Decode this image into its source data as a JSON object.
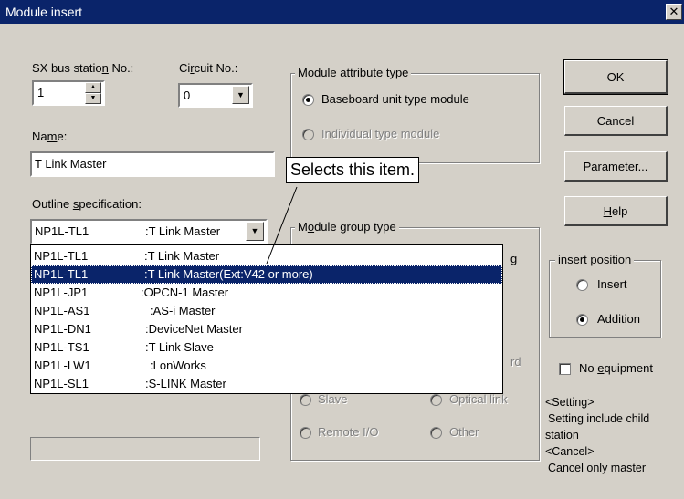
{
  "window": {
    "title": "Module insert",
    "close_glyph": "✕"
  },
  "sx_bus": {
    "label_pre": "SX bus statio",
    "label_u": "n",
    "label_post": " No.:",
    "value": "1"
  },
  "circuit": {
    "label_pre": "Ci",
    "label_u": "r",
    "label_post": "cuit No.:",
    "value": "0"
  },
  "name": {
    "label_pre": "Na",
    "label_u": "m",
    "label_post": "e:",
    "value": "T Link Master"
  },
  "outline": {
    "label_pre": "Outline ",
    "label_u": "s",
    "label_post": "pecification:",
    "selected_code": "NP1L-TL1",
    "selected_desc": ":T Link Master",
    "options": [
      {
        "code": "NP1L-TL1",
        "desc": ":T Link Master"
      },
      {
        "code": "NP1L-TL1",
        "desc": ":T Link Master(Ext:V42 or more)",
        "selected": true
      },
      {
        "code": "NP1L-JP1",
        "desc": ":OPCN-1 Master"
      },
      {
        "code": "NP1L-AS1",
        "desc": ":AS-i Master"
      },
      {
        "code": "NP1L-DN1",
        "desc": ":DeviceNet Master"
      },
      {
        "code": "NP1L-TS1",
        "desc": ":T Link Slave"
      },
      {
        "code": "NP1L-LW1",
        "desc": ":LonWorks"
      },
      {
        "code": "NP1L-SL1",
        "desc": ":S-LINK Master"
      }
    ]
  },
  "attr_type": {
    "legend_pre": "Module ",
    "legend_u": "a",
    "legend_post": "ttribute type",
    "baseboard": "Baseboard unit type module",
    "individual": "Individual type module"
  },
  "group_type": {
    "legend_pre": "M",
    "legend_u": "o",
    "legend_post": "dule group type",
    "partial_g": "g",
    "partial_rd": "rd",
    "slave": "Slave",
    "optical": "Optical link",
    "remote_io": "Remote I/O",
    "other": "Other"
  },
  "buttons": {
    "ok": "OK",
    "cancel": "Cancel",
    "parameter_u": "P",
    "parameter_post": "arameter...",
    "help_u": "H",
    "help_post": "elp"
  },
  "insert_position": {
    "legend_u": "i",
    "legend_post": "nsert position",
    "insert": "Insert",
    "addition": "Addition"
  },
  "no_equipment": {
    "pre": "No ",
    "u": "e",
    "post": "quipment"
  },
  "notes": {
    "line1": "<Setting>",
    "line2": "Setting include child",
    "line3": "station",
    "line4": "<Cancel>",
    "line5": "Cancel only master"
  },
  "callout": "Selects this item.",
  "icons": {
    "spin_up": "▲",
    "spin_down": "▼",
    "dropdown": "▼"
  }
}
